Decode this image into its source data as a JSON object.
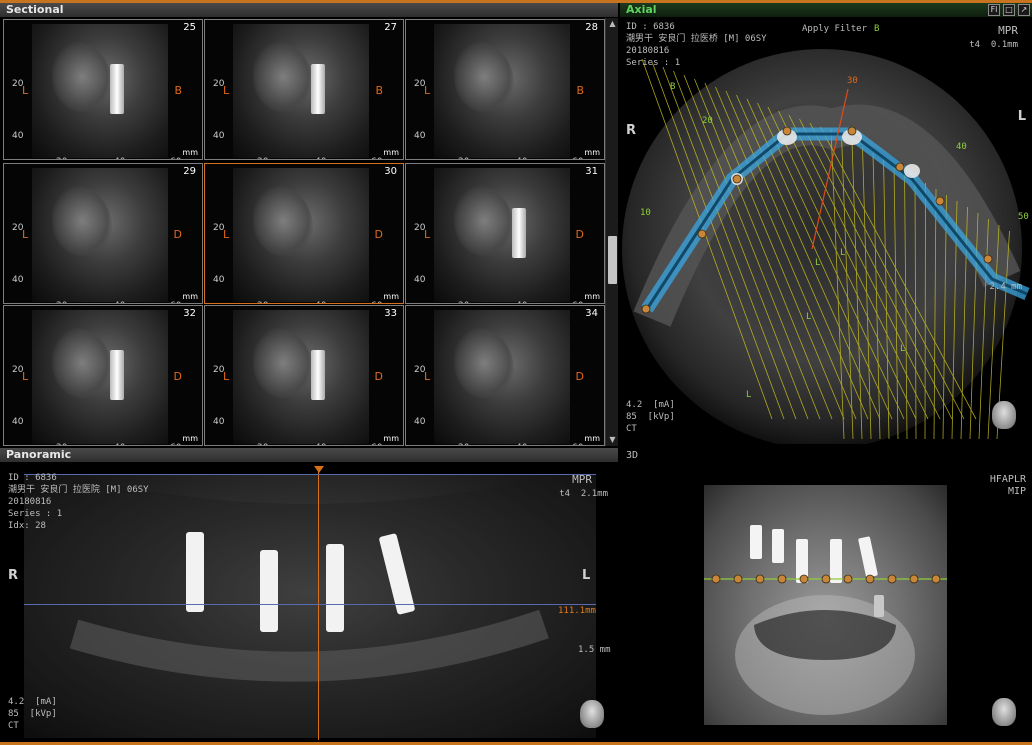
{
  "colors": {
    "accent": "#d6701a",
    "axial_header": "#5fd45f",
    "nerve_channel": "#3aa6e0",
    "guide_lines": "#c8c020"
  },
  "sectional": {
    "title": "Sectional",
    "cells": [
      {
        "num": "25",
        "left": "L",
        "right": "B"
      },
      {
        "num": "27",
        "left": "L",
        "right": "B"
      },
      {
        "num": "28",
        "left": "L",
        "right": "B"
      },
      {
        "num": "29",
        "left": "L",
        "right": "D"
      },
      {
        "num": "30",
        "left": "L",
        "right": "D"
      },
      {
        "num": "31",
        "left": "L",
        "right": "D"
      },
      {
        "num": "32",
        "left": "L",
        "right": "D"
      },
      {
        "num": "33",
        "left": "L",
        "right": "D"
      },
      {
        "num": "34",
        "left": "L",
        "right": "D"
      }
    ],
    "y_ticks": [
      "20",
      "40"
    ],
    "x_ticks": [
      "20",
      "40",
      "60"
    ],
    "unit": "mm"
  },
  "axial": {
    "title": "Axial",
    "info": "ID : 6836\n潮男干 安良门 拉医桥 [M] 06SY\n20180816\nSeries : 1",
    "mode": "MPR",
    "thickness": "t4  0.1mm",
    "filter": "Apply Filter",
    "scan": "4.2  [mA]\n85  [kVp]\nCT",
    "side_r": "R",
    "side_l": "L",
    "marks": [
      "B",
      "B",
      "30",
      "20",
      "10",
      "40",
      "50",
      "L",
      "L",
      "L",
      "L",
      "L"
    ],
    "scale": "2.4 mm",
    "win_btns": [
      "Fl",
      "□",
      "↗"
    ]
  },
  "panoramic": {
    "title": "Panoramic",
    "info": "ID : 6836\n潮男干 安良门 拉医院 [M] 06SY\n20180816\nSeries : 1\nIdx: 28",
    "mode": "MPR",
    "thickness": "t4  2.1mm",
    "scan": "4.2  [mA]\n85  [kVp]\nCT",
    "side_r": "R",
    "side_l": "L",
    "measure": "111.1mm",
    "scale": "1.5 mm"
  },
  "view3d": {
    "title": "3D",
    "orient": "HFAPLR",
    "mode": "MIP"
  },
  "scroll": {
    "up": "▲",
    "down": "▼"
  }
}
